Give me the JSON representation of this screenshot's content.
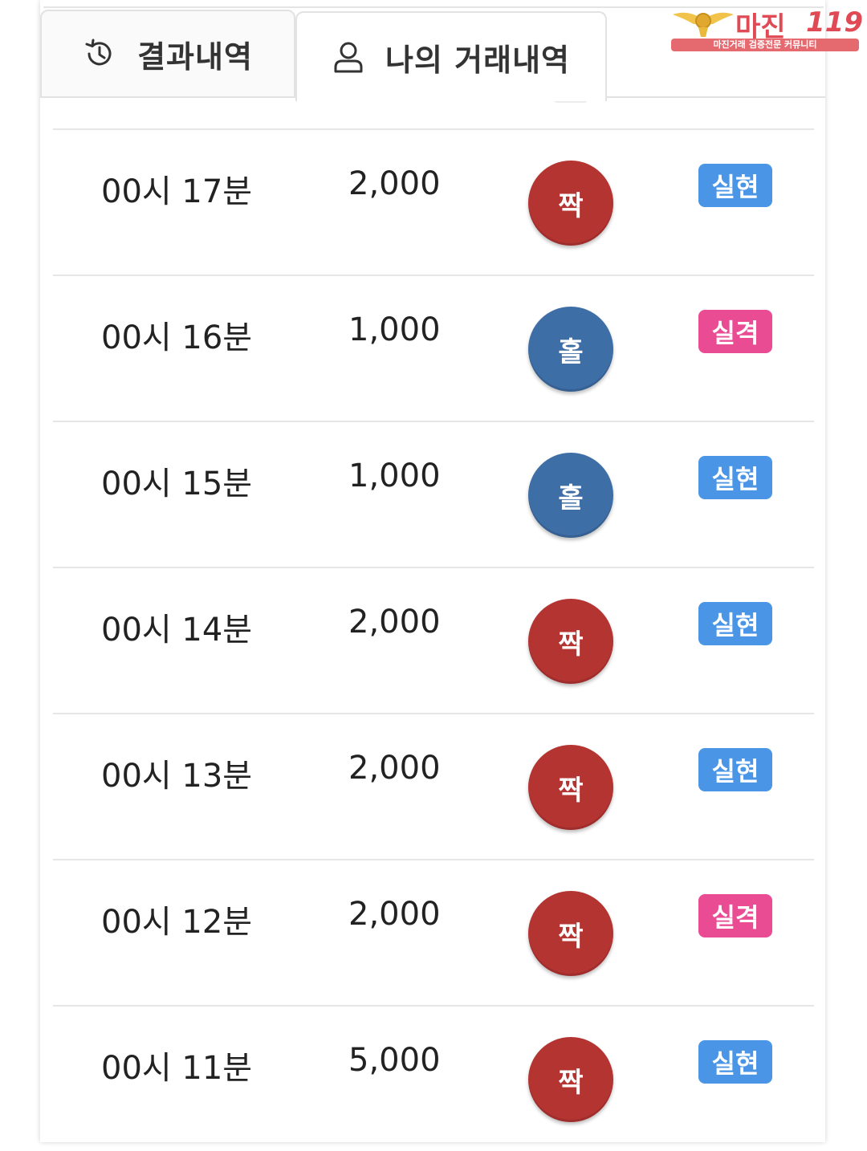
{
  "tabs": [
    {
      "label": "결과내역",
      "icon": "history-icon",
      "active": false
    },
    {
      "label": "나의 거래내역",
      "icon": "user-icon",
      "active": true
    }
  ],
  "logo": {
    "name": "마진",
    "number": "119",
    "tagline": "마진거래 검증전문 커뮤니티"
  },
  "colors": {
    "even_chip": "#b43432",
    "odd_chip": "#3e6ea6",
    "win_badge": "#4a95e6",
    "lose_badge": "#ea4c94",
    "logo": "#e04a55"
  },
  "rows": [
    {
      "time": "00시 17분",
      "amount": "2,000",
      "pick": "짝",
      "pick_type": "even",
      "result": "실현",
      "result_type": "win"
    },
    {
      "time": "00시 16분",
      "amount": "1,000",
      "pick": "홀",
      "pick_type": "odd",
      "result": "실격",
      "result_type": "lose"
    },
    {
      "time": "00시 15분",
      "amount": "1,000",
      "pick": "홀",
      "pick_type": "odd",
      "result": "실현",
      "result_type": "win"
    },
    {
      "time": "00시 14분",
      "amount": "2,000",
      "pick": "짝",
      "pick_type": "even",
      "result": "실현",
      "result_type": "win"
    },
    {
      "time": "00시 13분",
      "amount": "2,000",
      "pick": "짝",
      "pick_type": "even",
      "result": "실현",
      "result_type": "win"
    },
    {
      "time": "00시 12분",
      "amount": "2,000",
      "pick": "짝",
      "pick_type": "even",
      "result": "실격",
      "result_type": "lose"
    },
    {
      "time": "00시 11분",
      "amount": "5,000",
      "pick": "짝",
      "pick_type": "even",
      "result": "실현",
      "result_type": "win"
    }
  ]
}
